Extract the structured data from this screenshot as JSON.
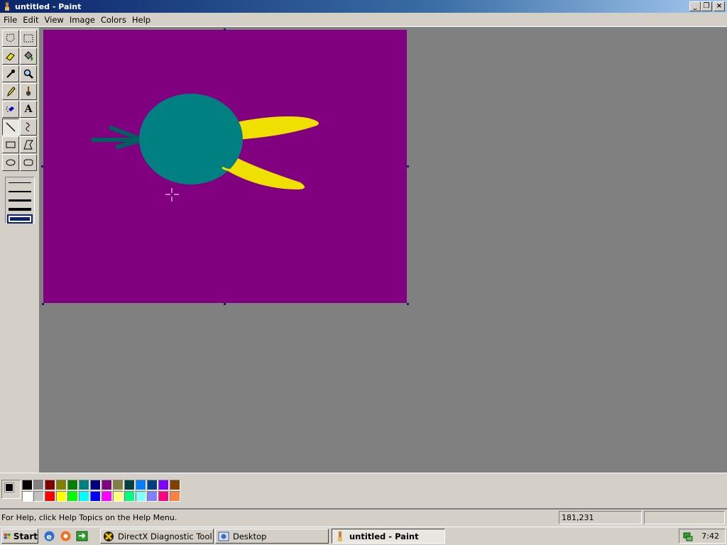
{
  "window": {
    "title": "untitled - Paint",
    "buttons": {
      "minimize": "_",
      "restore": "❐",
      "close": "×"
    }
  },
  "menu": [
    "File",
    "Edit",
    "View",
    "Image",
    "Colors",
    "Help"
  ],
  "tools": [
    {
      "name": "free-form-select",
      "active": false
    },
    {
      "name": "select",
      "active": false
    },
    {
      "name": "eraser",
      "active": false
    },
    {
      "name": "fill",
      "active": false
    },
    {
      "name": "pick-color",
      "active": false
    },
    {
      "name": "magnifier",
      "active": false
    },
    {
      "name": "pencil",
      "active": false
    },
    {
      "name": "brush",
      "active": false
    },
    {
      "name": "airbrush",
      "active": false
    },
    {
      "name": "text",
      "glyph": "A",
      "active": false
    },
    {
      "name": "line",
      "active": true
    },
    {
      "name": "curve",
      "active": false
    },
    {
      "name": "rectangle",
      "active": false
    },
    {
      "name": "polygon",
      "active": false
    },
    {
      "name": "ellipse",
      "active": false
    },
    {
      "name": "rounded-rectangle",
      "active": false
    }
  ],
  "canvas": {
    "background": "#800080",
    "drawing_colors": {
      "body": "#008080",
      "wing": "#f0e000"
    }
  },
  "palette": {
    "foreground": "#000000",
    "background": "#ffffff",
    "row1": [
      "#000000",
      "#808080",
      "#800000",
      "#808000",
      "#008000",
      "#008080",
      "#000080",
      "#800080",
      "#808040",
      "#004040",
      "#0080ff",
      "#004080",
      "#8000ff",
      "#804000"
    ],
    "row2": [
      "#ffffff",
      "#c0c0c0",
      "#ff0000",
      "#ffff00",
      "#00ff00",
      "#00ffff",
      "#0000ff",
      "#ff00ff",
      "#ffff80",
      "#00ff80",
      "#80ffff",
      "#8080ff",
      "#ff0080",
      "#ff8040"
    ]
  },
  "status": {
    "help": "For Help, click Help Topics on the Help Menu.",
    "coords": "181,231",
    "size": ""
  },
  "taskbar": {
    "start": "Start",
    "tasks": [
      {
        "label": "DirectX Diagnostic Tool",
        "active": false
      },
      {
        "label": "Desktop",
        "active": false
      },
      {
        "label": "untitled - Paint",
        "active": true
      }
    ],
    "clock": "7:42"
  }
}
